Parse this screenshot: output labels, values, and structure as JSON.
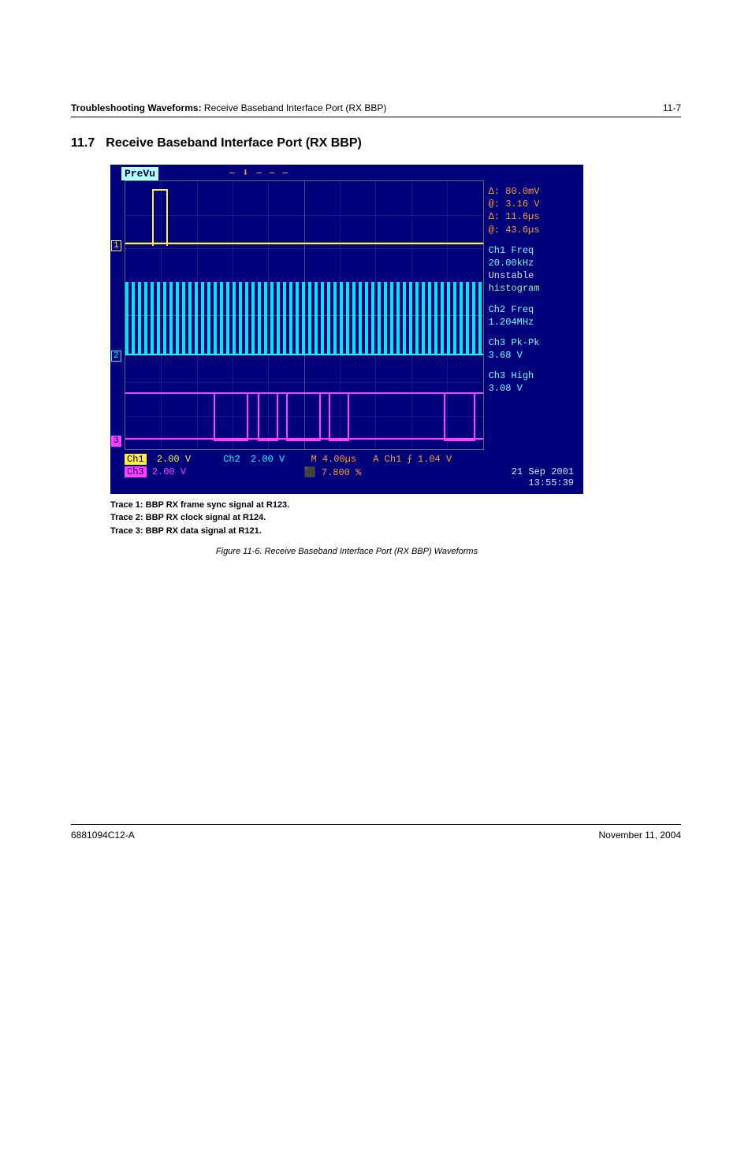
{
  "header": {
    "title_bold": "Troubleshooting Waveforms:",
    "title_rest": " Receive Baseband Interface Port (RX BBP)",
    "page_num": "11-7"
  },
  "section": {
    "number": "11.7",
    "title": "Receive Baseband Interface Port (RX BBP)"
  },
  "scope": {
    "prevu": "PreVu",
    "cursor": {
      "dv": "Δ:  80.0mV",
      "av": "@:  3.16 V",
      "dt": "Δ:  11.6µs",
      "at": "@:  43.6µs"
    },
    "meas": {
      "ch1_label": "Ch1 Freq",
      "ch1_val": "20.00kHz",
      "ch1_note1": "Unstable",
      "ch1_note2": "histogram",
      "ch2_label": "Ch2 Freq",
      "ch2_val": "1.204MHz",
      "ch3a_label": "Ch3 Pk-Pk",
      "ch3a_val": "3.68 V",
      "ch3b_label": "Ch3 High",
      "ch3b_val": "3.08 V"
    },
    "bottom": {
      "ch1_lbl": "Ch1",
      "ch1_scale": "2.00 V",
      "ch2_lbl": "Ch2",
      "ch2_scale": "2.00 V",
      "timebase": "M 4.00µs",
      "trig": "A  Ch1 ⨍   1.04 V",
      "ch3_lbl": "Ch3",
      "ch3_scale": "2.00 V",
      "trigpos": "⬛ 7.800 %",
      "date": "21 Sep 2001",
      "time": "13:55:39"
    }
  },
  "legend": {
    "l1": "Trace 1: BBP RX frame sync signal at R123.",
    "l2": "Trace 2: BBP RX clock signal at R124.",
    "l3": "Trace 3: BBP RX data signal at R121."
  },
  "caption": "Figure 11-6.  Receive Baseband Interface Port (RX BBP) Waveforms",
  "footer": {
    "left": "6881094C12-A",
    "right": "November 11, 2004"
  }
}
